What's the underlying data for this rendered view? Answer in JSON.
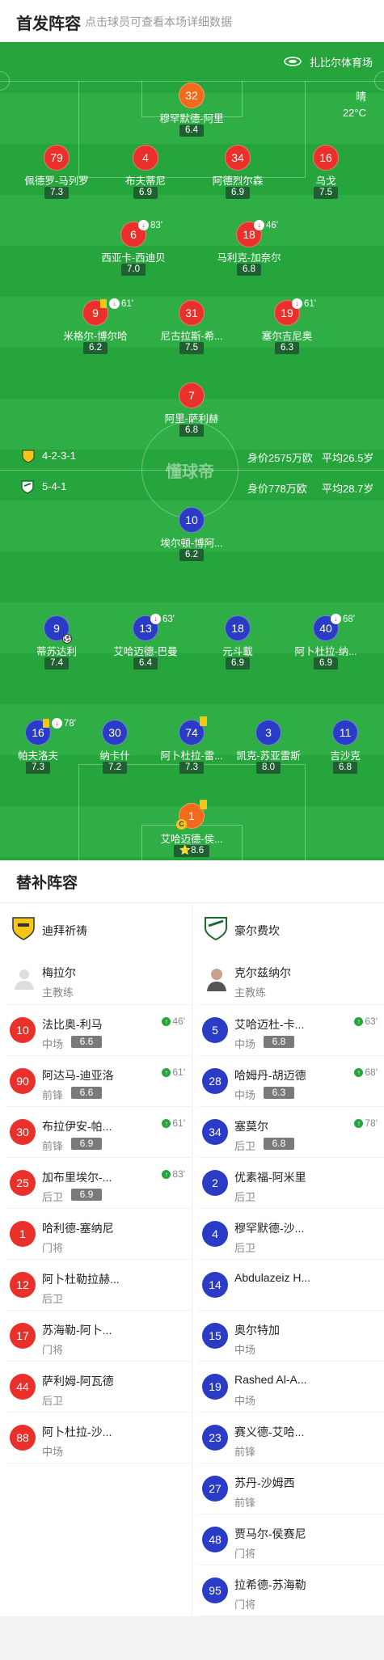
{
  "header": {
    "title": "首发阵容",
    "subtitle": "点击球员可查看本场详细数据"
  },
  "venue": {
    "name": "扎比尔体育场",
    "weather": "晴",
    "temperature": "22°C"
  },
  "watermark": "懂球帝",
  "home_team": {
    "formation": "4-2-3-1",
    "value": "身价2575万欧",
    "avg_age": "平均26.5岁",
    "color": "#e9302b"
  },
  "away_team": {
    "formation": "5-4-1",
    "value": "身价778万欧",
    "avg_age": "平均28.7岁",
    "color": "#2a3cc6"
  },
  "home_players": [
    {
      "num": "32",
      "name": "穆罕默德-阿里",
      "rating": "6.4",
      "gk": true
    },
    {
      "num": "79",
      "name": "佩德罗-马列罗",
      "rating": "7.3"
    },
    {
      "num": "4",
      "name": "布夫蒂尼",
      "rating": "6.9"
    },
    {
      "num": "34",
      "name": "阿德烈尔森",
      "rating": "6.9"
    },
    {
      "num": "16",
      "name": "乌戈",
      "rating": "7.5"
    },
    {
      "num": "6",
      "name": "西亚卡-西迪贝",
      "rating": "7.0",
      "sub_off": "83'"
    },
    {
      "num": "18",
      "name": "马利克-加奈尔",
      "rating": "6.8",
      "sub_off": "46'"
    },
    {
      "num": "9",
      "name": "米格尔-博尔哈",
      "rating": "6.2",
      "yellow": true,
      "sub_off": "61'"
    },
    {
      "num": "31",
      "name": "尼古拉斯-希...",
      "rating": "7.5"
    },
    {
      "num": "19",
      "name": "塞尔吉尼奥",
      "rating": "6.3",
      "sub_off": "61'"
    },
    {
      "num": "7",
      "name": "阿里-萨利赫",
      "rating": "6.8"
    }
  ],
  "away_players": [
    {
      "num": "10",
      "name": "埃尔顿-博阿...",
      "rating": "6.2"
    },
    {
      "num": "9",
      "name": "蒂苏达利",
      "rating": "7.4",
      "goal": true
    },
    {
      "num": "13",
      "name": "艾哈迈德-巴曼",
      "rating": "6.4",
      "sub_off": "63'"
    },
    {
      "num": "18",
      "name": "元斗載",
      "rating": "6.9"
    },
    {
      "num": "40",
      "name": "阿卜杜拉-纳...",
      "rating": "6.9",
      "sub_off": "68'"
    },
    {
      "num": "16",
      "name": "帕夫洛夫",
      "rating": "7.3",
      "yellow": true,
      "sub_off": "78'"
    },
    {
      "num": "30",
      "name": "纳卡什",
      "rating": "7.2"
    },
    {
      "num": "74",
      "name": "阿卜杜拉-雷...",
      "rating": "7.3",
      "yellow_solo": true
    },
    {
      "num": "3",
      "name": "凯克-苏亚雷斯",
      "rating": "8.0"
    },
    {
      "num": "11",
      "name": "吉沙克",
      "rating": "6.8"
    },
    {
      "num": "1",
      "name": "艾哈迈德-侯...",
      "rating": "8.6",
      "gk": true,
      "captain": true,
      "yellow_solo": true,
      "mvp": true
    }
  ],
  "subs": {
    "title": "替补阵容",
    "home": {
      "team": "迪拜祈祷",
      "coach_name": "梅拉尔",
      "coach_role": "主教练",
      "players": [
        {
          "num": "10",
          "name": "法比奥-利马",
          "pos": "中场",
          "rating": "6.6",
          "on": "46'"
        },
        {
          "num": "90",
          "name": "阿达马-迪亚洛",
          "pos": "前锋",
          "rating": "6.6",
          "on": "61'"
        },
        {
          "num": "30",
          "name": "布拉伊安-帕...",
          "pos": "前锋",
          "rating": "6.9",
          "on": "61'"
        },
        {
          "num": "25",
          "name": "加布里埃尔-...",
          "pos": "后卫",
          "rating": "6.9",
          "on": "83'"
        },
        {
          "num": "1",
          "name": "哈利德-塞纳尼",
          "pos": "门将"
        },
        {
          "num": "12",
          "name": "阿卜杜勒拉赫...",
          "pos": "后卫"
        },
        {
          "num": "17",
          "name": "苏海勒-阿卜...",
          "pos": "门将"
        },
        {
          "num": "44",
          "name": "萨利姆-阿瓦德",
          "pos": "后卫"
        },
        {
          "num": "88",
          "name": "阿卜杜拉-沙...",
          "pos": "中场"
        }
      ]
    },
    "away": {
      "team": "豪尔费坎",
      "coach_name": "克尔兹纳尔",
      "coach_role": "主教练",
      "players": [
        {
          "num": "5",
          "name": "艾哈迈杜-卡...",
          "pos": "中场",
          "rating": "6.8",
          "on": "63'"
        },
        {
          "num": "28",
          "name": "哈姆丹-胡迈德",
          "pos": "中场",
          "rating": "6.3",
          "on": "68'"
        },
        {
          "num": "34",
          "name": "塞莫尔",
          "pos": "后卫",
          "rating": "6.8",
          "on": "78'"
        },
        {
          "num": "2",
          "name": "优素福-阿米里",
          "pos": "后卫"
        },
        {
          "num": "4",
          "name": "穆罕默德-沙...",
          "pos": "后卫"
        },
        {
          "num": "14",
          "name": "Abdulazeiz H...",
          "pos": ""
        },
        {
          "num": "15",
          "name": "奥尔特加",
          "pos": "中场"
        },
        {
          "num": "19",
          "name": "Rashed Al-A...",
          "pos": "中场"
        },
        {
          "num": "23",
          "name": "赛义德-艾哈...",
          "pos": "前锋"
        },
        {
          "num": "27",
          "name": "苏丹-沙姆西",
          "pos": "前锋"
        },
        {
          "num": "48",
          "name": "贾马尔-侯赛尼",
          "pos": "门将"
        },
        {
          "num": "95",
          "name": "拉希德-苏海勒",
          "pos": "门将"
        }
      ]
    }
  }
}
